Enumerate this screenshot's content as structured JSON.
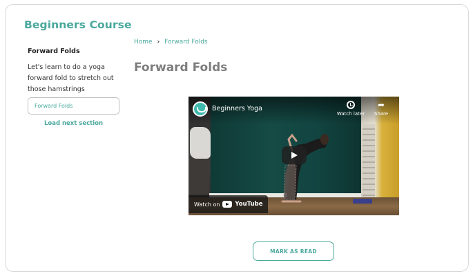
{
  "course": {
    "title": "Beginners Course"
  },
  "sidebar": {
    "heading": "Forward Folds",
    "description": "Let's learn to do a yoga forward fold to stretch out those hamstrings",
    "sections": [
      {
        "label": "Forward Folds"
      }
    ],
    "load_next_label": "Load next section"
  },
  "breadcrumb": {
    "home": "Home",
    "separator": "›",
    "current": "Forward Folds"
  },
  "main": {
    "title": "Forward Folds"
  },
  "video": {
    "title": "Beginners Yoga",
    "watch_later_label": "Watch later",
    "share_label": "Share",
    "watch_on_label": "Watch on",
    "platform_label": "YouTube",
    "channel_icon": "yoga-channel-icon",
    "play_icon": "play-icon"
  },
  "actions": {
    "mark_read_label": "MARK AS READ"
  },
  "colors": {
    "accent": "#4aa89d",
    "title_gray": "#7d7d7d"
  }
}
